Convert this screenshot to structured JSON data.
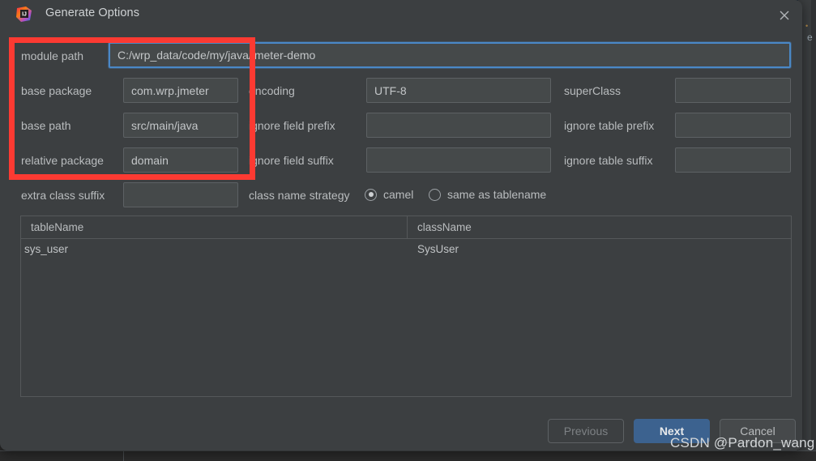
{
  "window": {
    "title": "Generate Options",
    "app_icon": "intellij-idea-icon",
    "close_icon": "close-icon"
  },
  "form": {
    "module_path": {
      "label": "module path",
      "value": "C:/wrp_data/code/my/java/jmeter-demo",
      "focused": true
    },
    "left_column": [
      {
        "label": "base package",
        "value": "com.wrp.jmeter"
      },
      {
        "label": "base path",
        "value": "src/main/java"
      },
      {
        "label": "relative package",
        "value": "domain"
      },
      {
        "label": "extra class suffix",
        "value": ""
      }
    ],
    "middle_column": [
      {
        "label": "encoding",
        "value": "UTF-8"
      },
      {
        "label": "ignore field prefix",
        "value": ""
      },
      {
        "label": "ignore field suffix",
        "value": ""
      }
    ],
    "right_column": [
      {
        "label": "superClass",
        "value": ""
      },
      {
        "label": "ignore table prefix",
        "value": ""
      },
      {
        "label": "ignore table suffix",
        "value": ""
      }
    ],
    "class_name_strategy": {
      "label": "class name strategy",
      "options": [
        {
          "label": "camel",
          "selected": true
        },
        {
          "label": "same as tablename",
          "selected": false
        }
      ]
    }
  },
  "table": {
    "columns": [
      "tableName",
      "className"
    ],
    "rows": [
      {
        "tableName": "sys_user",
        "className": "SysUser"
      }
    ]
  },
  "footer": {
    "previous_label": "Previous",
    "next_label": "Next",
    "cancel_label": "Cancel"
  },
  "annotation": {
    "highlight_color": "#fc3a32"
  },
  "watermark": {
    "text": "CSDN @Pardon_wang"
  },
  "ide": {
    "edge_char": "e",
    "edge_dot": "•"
  },
  "colors": {
    "dialog_bg": "#3c3f41",
    "field_bg": "#45494a",
    "field_border": "#5d6164",
    "focus_border": "#4a88c7",
    "primary_button": "#3c628f",
    "text": "#b9bcbe"
  }
}
